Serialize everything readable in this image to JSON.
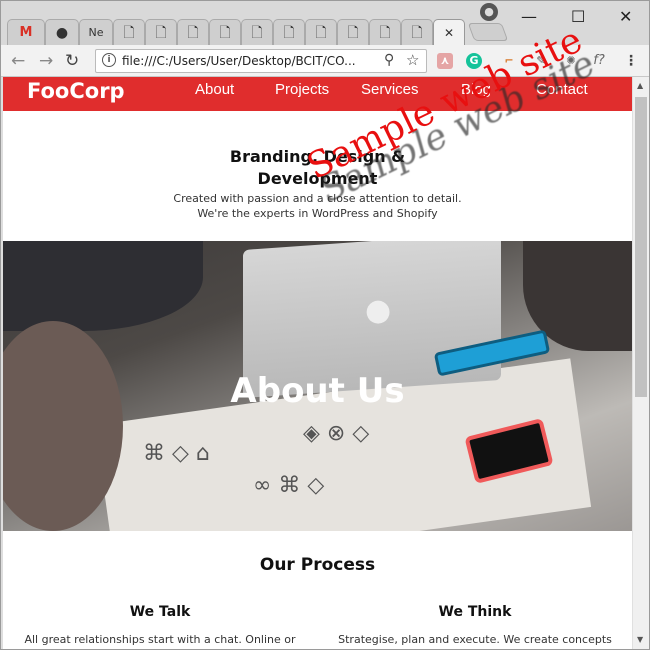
{
  "browser": {
    "tabs": [
      {
        "label": "M",
        "kind": "gmail"
      },
      {
        "label": "",
        "kind": "github"
      },
      {
        "label": "Ne",
        "kind": "page"
      },
      {
        "label": "",
        "kind": "doc"
      },
      {
        "label": "",
        "kind": "doc"
      },
      {
        "label": "",
        "kind": "doc"
      },
      {
        "label": "",
        "kind": "doc"
      },
      {
        "label": "",
        "kind": "doc"
      },
      {
        "label": "",
        "kind": "doc"
      },
      {
        "label": "",
        "kind": "doc"
      },
      {
        "label": "",
        "kind": "doc"
      },
      {
        "label": "",
        "kind": "doc"
      },
      {
        "label": "",
        "kind": "doc"
      },
      {
        "label": "",
        "kind": "active"
      }
    ],
    "address": "file:///C:/Users/User/Desktop/BCIT/CO...",
    "close_symbol": "✕",
    "minimize_symbol": "—",
    "maximize_symbol": "☐",
    "ext_fx": "f?"
  },
  "site": {
    "brand": "FooCorp",
    "nav": [
      "About",
      "Projects",
      "Services",
      "Blog",
      "Contact"
    ],
    "headline_line1": "Branding, Design &",
    "headline_line2": "Development",
    "sub_line1": "Created with passion and a close attention to detail.",
    "sub_line2": "We're the experts in WordPress and Shopify",
    "hero_title": "About Us",
    "process_title": "Our Process",
    "col1_title": "We Talk",
    "col1_text": "All great relationships start with a chat. Online or",
    "col2_title": "We Think",
    "col2_text": "Strategise, plan and execute. We create concepts"
  },
  "watermark": "Sample web site",
  "colors": {
    "brand_red": "#e02d2d",
    "watermark_red": "#e81010"
  }
}
